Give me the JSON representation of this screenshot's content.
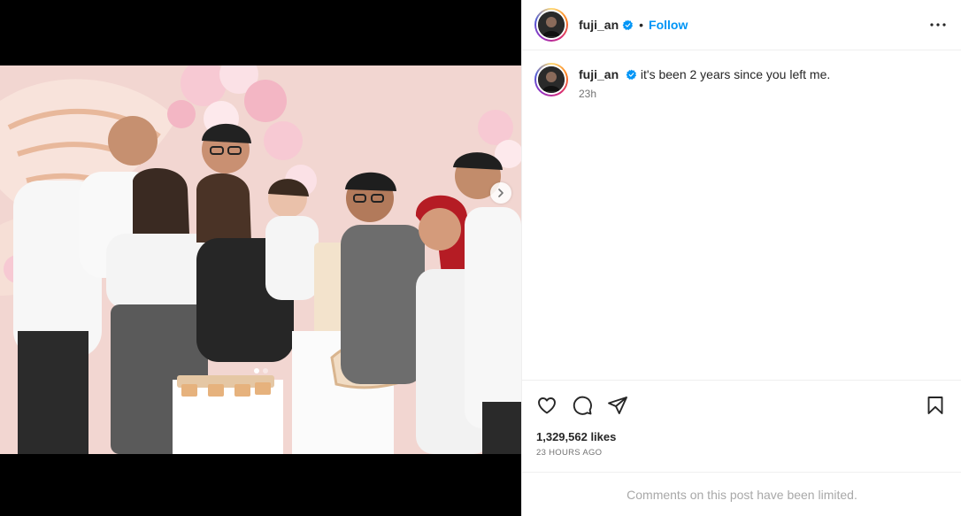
{
  "header": {
    "username": "fuji_an",
    "separator": "•",
    "follow_label": "Follow",
    "avatar_icon": "profile-avatar",
    "verified_icon": "verified-badge-icon",
    "more_icon": "more-options-icon"
  },
  "caption": {
    "username": "fuji_an",
    "text": "it's been 2 years since you left me.",
    "time": "23h"
  },
  "actions": {
    "like_icon": "heart-icon",
    "comment_icon": "comment-icon",
    "share_icon": "share-icon",
    "save_icon": "bookmark-icon"
  },
  "stats": {
    "likes": "1,329,562 likes",
    "time_ago": "23 HOURS AGO"
  },
  "comments": {
    "limited_text": "Comments on this post have been limited."
  },
  "media": {
    "slide_count": 2,
    "current_slide": 1,
    "next_icon": "chevron-right-icon"
  },
  "colors": {
    "accent": "#0095f6",
    "verified": "#0095f6",
    "muted": "#737373",
    "border": "#efefef"
  }
}
